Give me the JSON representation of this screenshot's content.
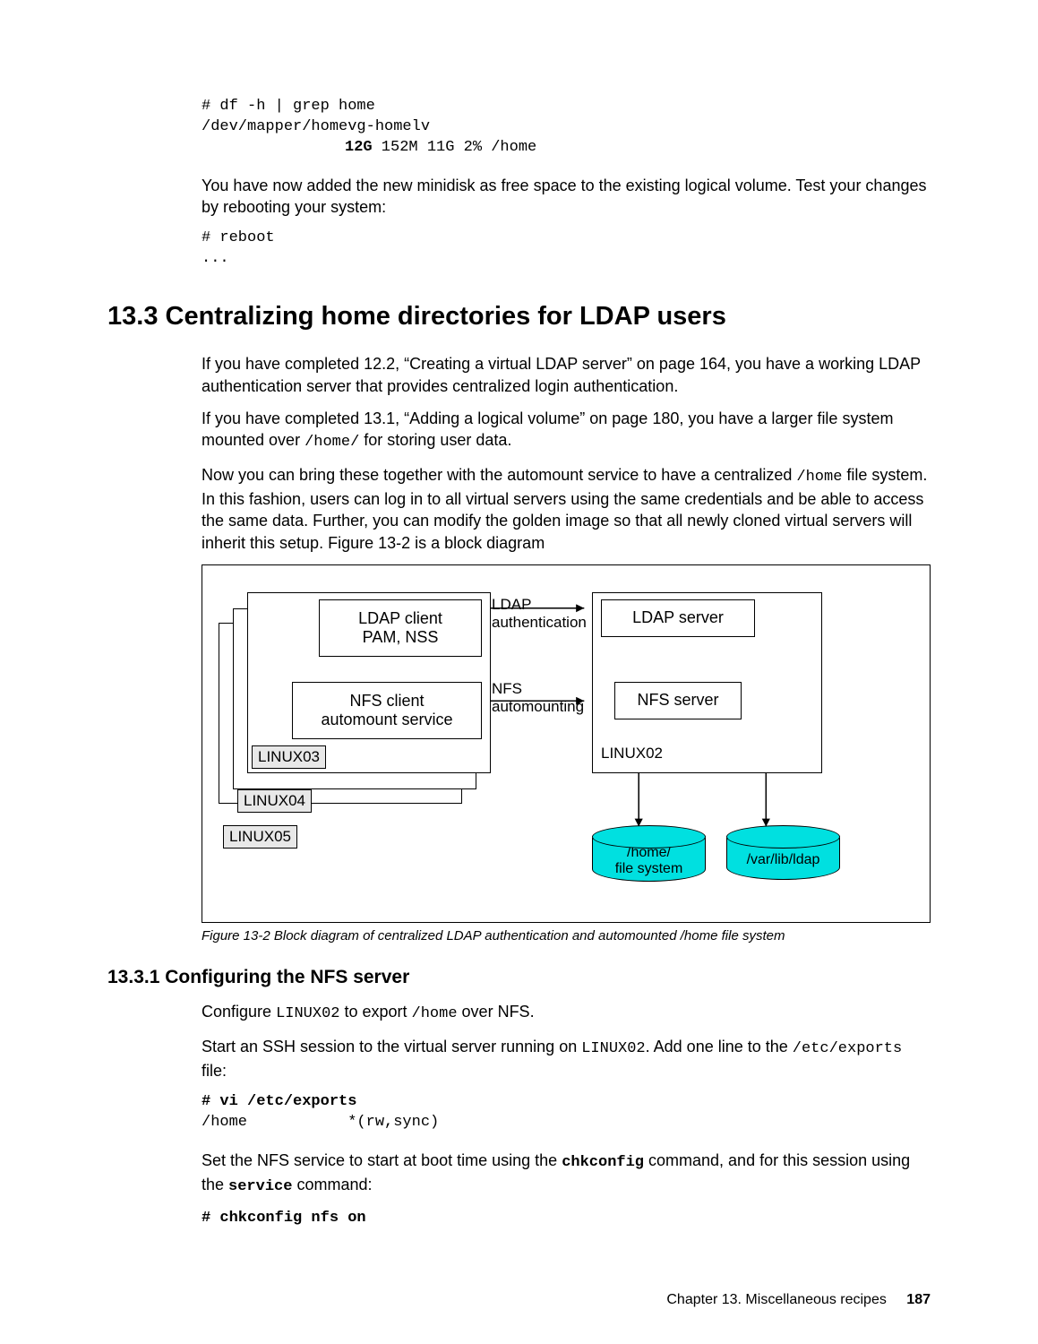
{
  "code1": {
    "l1": "# df -h | grep home",
    "l2": "/dev/mapper/homevg-homelv",
    "l3a": "12G",
    "l3b": "  152M   11G   2% /home"
  },
  "p1": "You have now added the new minidisk as free space to the existing logical volume. Test your changes by rebooting your system:",
  "code2": {
    "l1": "# reboot",
    "l2": "..."
  },
  "h1": "13.3  Centralizing home directories for LDAP users",
  "p2": "If you have completed 12.2, “Creating a virtual LDAP server” on page 164, you have a working LDAP authentication server that provides centralized login authentication.",
  "p3a": "If you have completed 13.1, “Adding a logical volume” on page 180, you have a larger file system mounted over ",
  "p3m": "/home/",
  "p3b": " for storing user data.",
  "p4a": "Now you can bring these together with the automount service to have a centralized ",
  "p4m": "/home",
  "p4b": " file system. In this fashion, users can log in to all virtual servers using the same credentials and be able to access the same data. Further, you can modify the golden image so that all newly cloned virtual servers will inherit this setup. Figure 13-2 is a block diagram",
  "fig": {
    "ldapclient1": "LDAP client",
    "ldapclient2": "PAM, NSS",
    "nfsclient1": "NFS client",
    "nfsclient2": "automount service",
    "linux03": "LINUX03",
    "linux04": "LINUX04",
    "linux05": "LINUX05",
    "ldapauth1": "LDAP",
    "ldapauth2": "authentication",
    "nfsauto1": "NFS",
    "nfsauto2": "automounting",
    "ldapserver": "LDAP server",
    "nfsserver": "NFS server",
    "linux02": "LINUX02",
    "cyl1a": "/home/",
    "cyl1b": "file system",
    "cyl2": "/var/lib/ldap"
  },
  "figcap": "Figure 13-2   Block diagram of centralized LDAP authentication and automounted /home file system",
  "h2": "13.3.1  Configuring the NFS server",
  "p5a": "Configure ",
  "p5m": "LINUX02",
  "p5b": " to export ",
  "p5m2": "/home",
  "p5c": " over NFS.",
  "p6a": "Start an SSH session to the virtual server running on ",
  "p6m": "LINUX02",
  "p6b": ". Add one line to the ",
  "p6m2": "/etc/exports",
  "p6c": " file:",
  "code3": {
    "l1": "# vi /etc/exports",
    "l2": "/home           *(rw,sync)"
  },
  "p7a": "Set the NFS service to start at boot time using the ",
  "p7m": "chkconfig",
  "p7b": " command, and for this session using the ",
  "p7m2": "service",
  "p7c": " command:",
  "code4": {
    "l1": "# chkconfig nfs on"
  },
  "footer": {
    "chap": "Chapter 13. Miscellaneous recipes",
    "page": "187"
  }
}
